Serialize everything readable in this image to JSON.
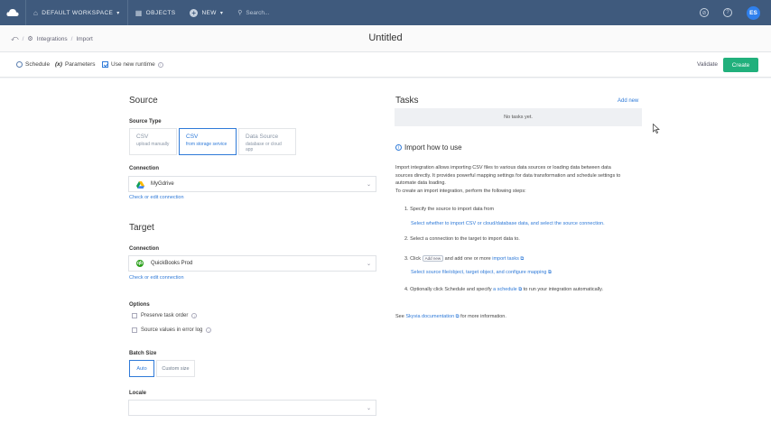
{
  "topbar": {
    "workspace": "DEFAULT WORKSPACE",
    "objects": "OBJECTS",
    "new": "NEW",
    "search_placeholder": "Search...",
    "avatar_initials": "ES"
  },
  "header": {
    "breadcrumb": [
      "Integrations",
      "Import"
    ],
    "title": "Untitled"
  },
  "toolbar": {
    "schedule": "Schedule",
    "parameters_prefix": "(x)",
    "parameters": "Parameters",
    "use_new_runtime": "Use new runtime",
    "validate": "Validate",
    "create": "Create"
  },
  "source": {
    "heading": "Source",
    "type_label": "Source Type",
    "types": [
      {
        "title": "CSV",
        "subtitle": "upload manually",
        "selected": false
      },
      {
        "title": "CSV",
        "subtitle": "from storage service",
        "selected": true
      },
      {
        "title": "Data Source",
        "subtitle": "database or cloud app",
        "selected": false
      }
    ],
    "connection_label": "Connection",
    "connection_value": "MyGdrive",
    "check_link": "Check or edit connection"
  },
  "target": {
    "heading": "Target",
    "connection_label": "Connection",
    "connection_value": "QuickBooks Prod",
    "qb_glyph": "qb",
    "check_link": "Check or edit connection"
  },
  "options": {
    "label": "Options",
    "items": [
      "Preserve task order",
      "Source values in error log"
    ]
  },
  "batch": {
    "label": "Batch Size",
    "auto": "Auto",
    "custom": "Custom size"
  },
  "locale": {
    "label": "Locale",
    "value": ""
  },
  "tasks": {
    "heading": "Tasks",
    "add_new": "Add new",
    "empty": "No tasks yet."
  },
  "howto": {
    "title": "Import how to use",
    "intro1": "Import integration allows importing CSV files to various data sources or loading data between data",
    "intro2": "sources directly. It provides powerful mapping settings for data transformation and schedule settings to",
    "intro3": "automate data loading.",
    "intro4": "To create an import integration, perform the following steps:",
    "step1": "1. Specify the source to import data from",
    "step1_sub": "Select whether to import CSV or cloud/database data, and select the source connection.",
    "step2": "2. Select a connection to the target to import data to.",
    "step3_a": "3. Click",
    "step3_pill": "Add new",
    "step3_b": "and add one or more",
    "step3_link": "import tasks",
    "step3_sub_a": "Select source file/object, target object, and configure",
    "step3_sub_link": "mapping",
    "step4_a": "4. Optionally click Schedule and specify",
    "step4_link": "a schedule",
    "step4_b": "to run your integration automatically.",
    "see_a": "See",
    "see_link": "Skyvia documentation",
    "see_b": "for more information."
  },
  "colors": {
    "topbar": "#3f5a7d",
    "accent": "#2f7ad8",
    "create": "#21b07c"
  }
}
